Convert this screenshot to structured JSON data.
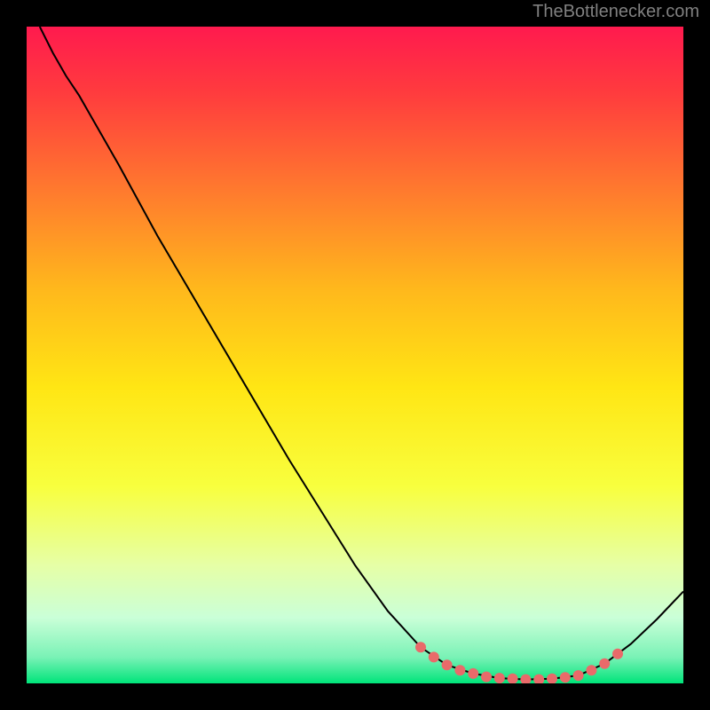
{
  "watermark": "TheBottlenecker.com",
  "chart_data": {
    "type": "line",
    "title": "",
    "xlabel": "",
    "ylabel": "",
    "xlim": [
      0,
      100
    ],
    "ylim": [
      0,
      100
    ],
    "background_gradient": {
      "stops": [
        {
          "offset": 0.0,
          "color": "#ff1a4e"
        },
        {
          "offset": 0.1,
          "color": "#ff3b3e"
        },
        {
          "offset": 0.25,
          "color": "#ff7a2e"
        },
        {
          "offset": 0.4,
          "color": "#ffb81c"
        },
        {
          "offset": 0.55,
          "color": "#ffe614"
        },
        {
          "offset": 0.7,
          "color": "#f8ff3e"
        },
        {
          "offset": 0.82,
          "color": "#e6ffa6"
        },
        {
          "offset": 0.9,
          "color": "#caffd8"
        },
        {
          "offset": 0.96,
          "color": "#7af2b6"
        },
        {
          "offset": 1.0,
          "color": "#00e47a"
        }
      ]
    },
    "series": [
      {
        "name": "curve",
        "type": "line",
        "points": [
          {
            "x": 2,
            "y": 100
          },
          {
            "x": 4,
            "y": 96
          },
          {
            "x": 6,
            "y": 92.5
          },
          {
            "x": 8,
            "y": 89.5
          },
          {
            "x": 10,
            "y": 86
          },
          {
            "x": 12,
            "y": 82.5
          },
          {
            "x": 14,
            "y": 79
          },
          {
            "x": 20,
            "y": 68
          },
          {
            "x": 30,
            "y": 51
          },
          {
            "x": 40,
            "y": 34
          },
          {
            "x": 50,
            "y": 18
          },
          {
            "x": 55,
            "y": 11
          },
          {
            "x": 60,
            "y": 5.5
          },
          {
            "x": 64,
            "y": 2.8
          },
          {
            "x": 68,
            "y": 1.5
          },
          {
            "x": 72,
            "y": 0.8
          },
          {
            "x": 76,
            "y": 0.6
          },
          {
            "x": 80,
            "y": 0.7
          },
          {
            "x": 84,
            "y": 1.2
          },
          {
            "x": 88,
            "y": 3.0
          },
          {
            "x": 92,
            "y": 6.0
          },
          {
            "x": 96,
            "y": 9.8
          },
          {
            "x": 100,
            "y": 14
          }
        ]
      },
      {
        "name": "markers",
        "type": "scatter",
        "points": [
          {
            "x": 60,
            "y": 5.5
          },
          {
            "x": 62,
            "y": 4.0
          },
          {
            "x": 64,
            "y": 2.8
          },
          {
            "x": 66,
            "y": 2.0
          },
          {
            "x": 68,
            "y": 1.5
          },
          {
            "x": 70,
            "y": 1.0
          },
          {
            "x": 72,
            "y": 0.8
          },
          {
            "x": 74,
            "y": 0.7
          },
          {
            "x": 76,
            "y": 0.6
          },
          {
            "x": 78,
            "y": 0.6
          },
          {
            "x": 80,
            "y": 0.7
          },
          {
            "x": 82,
            "y": 0.9
          },
          {
            "x": 84,
            "y": 1.2
          },
          {
            "x": 86,
            "y": 2.0
          },
          {
            "x": 88,
            "y": 3.0
          },
          {
            "x": 90,
            "y": 4.5
          }
        ]
      }
    ]
  }
}
